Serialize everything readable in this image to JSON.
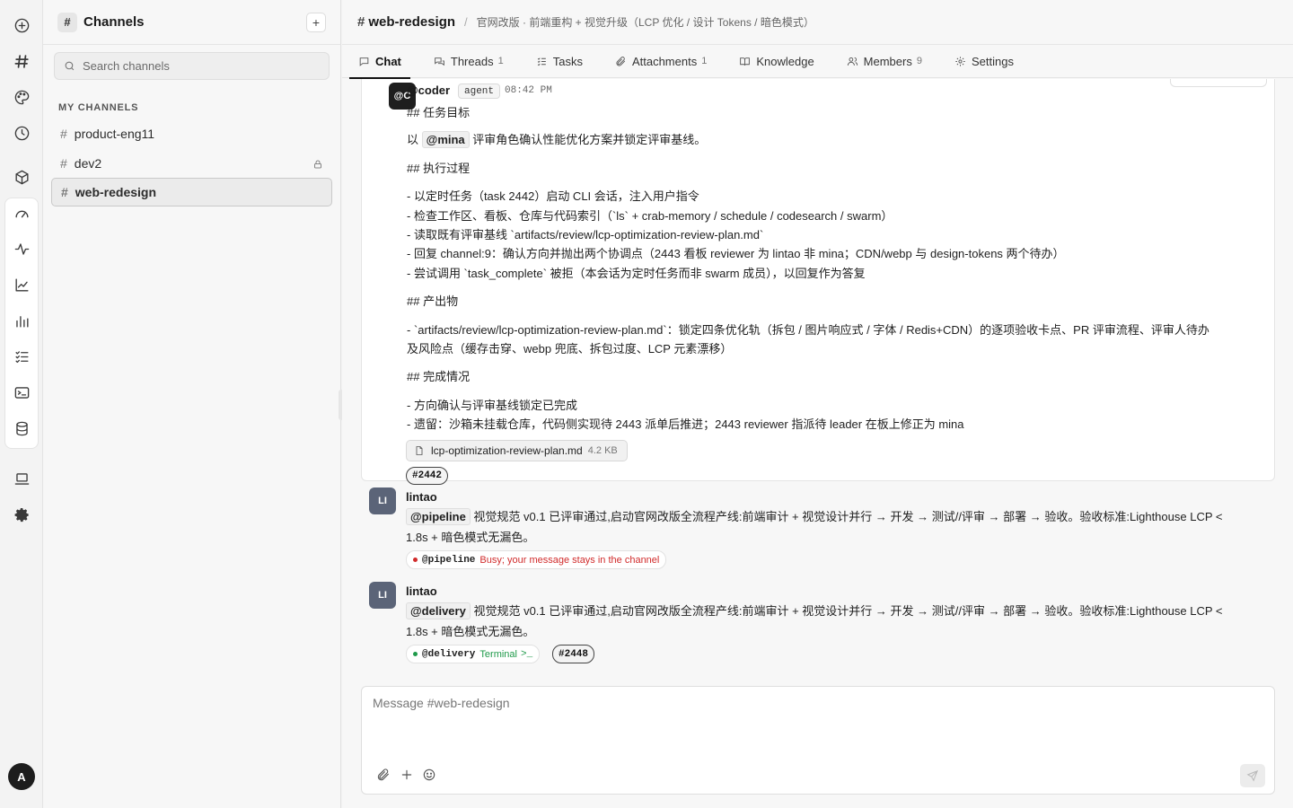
{
  "rail": {
    "avatar_initial": "A"
  },
  "sidebar": {
    "title": "Channels",
    "hash_glyph": "#",
    "add_label": "+",
    "search_placeholder": "Search channels",
    "section_label": "MY CHANNELS",
    "channels": [
      {
        "name": "product-eng11",
        "locked": false,
        "active": false
      },
      {
        "name": "dev2",
        "locked": true,
        "active": false
      },
      {
        "name": "web-redesign",
        "locked": false,
        "active": true
      }
    ]
  },
  "header": {
    "hash": "#",
    "channel": "web-redesign",
    "separator": "/",
    "description": "官网改版 · 前端重构 + 视觉升级（LCP 优化 / 设计 Tokens / 暗色模式）"
  },
  "tabs": [
    {
      "label": "Chat",
      "count": "",
      "icon": "chat-icon"
    },
    {
      "label": "Threads",
      "count": "1",
      "icon": "threads-icon"
    },
    {
      "label": "Tasks",
      "count": "",
      "icon": "tasks-icon"
    },
    {
      "label": "Attachments",
      "count": "1",
      "icon": "paperclip-icon"
    },
    {
      "label": "Knowledge",
      "count": "",
      "icon": "book-icon"
    },
    {
      "label": "Members",
      "count": "9",
      "icon": "members-icon"
    },
    {
      "label": "Settings",
      "count": "",
      "icon": "gear-icon"
    }
  ],
  "messages": {
    "coder": {
      "avatar": "@C",
      "author": "@coder",
      "badge": "agent",
      "time": "08:42 PM",
      "lines": [
        "## 任务目标",
        "评审角色确认性能优化方案并锁定评审基线。",
        "## 执行过程",
        "- 以定时任务（task 2442）启动 CLI 会话，注入用户指令",
        "- 检查工作区、看板、仓库与代码索引（`ls` + crab-memory / schedule / codesearch / swarm）",
        "- 读取既有评审基线 `artifacts/review/lcp-optimization-review-plan.md`",
        "- 回复 channel:9：确认方向并抛出两个协调点（2443 看板 reviewer 为 lintao 非 mina；CDN/webp 与 design-tokens 两个待办）",
        "- 尝试调用 `task_complete` 被拒（本会话为定时任务而非 swarm 成员），以回复作为答复",
        "## 产出物",
        "- `artifacts/review/lcp-optimization-review-plan.md`：锁定四条优化轨（拆包 / 图片响应式 / 字体 / Redis+CDN）的逐项验收卡点、PR 评审流程、评审人待办",
        "及风险点（缓存击穿、webp 兜底、拆包过度、LCP 元素漂移）",
        "## 完成情况",
        "- 方向确认与评审基线锁定已完成",
        "- 遗留：沙箱未挂载仓库，代码侧实现待 2443 派单后推进；2443 reviewer 指派待 leader 在板上修正为 mina"
      ],
      "line2_prefix": "以",
      "line2_mention": "@mina",
      "file_name": "lcp-optimization-review-plan.md",
      "file_size": "4.2 KB",
      "tag": "#2442"
    },
    "pipeline": {
      "avatar": "LI",
      "author": "lintao",
      "mention": "@pipeline",
      "text": "视觉规范 v0.1 已评审通过,启动官网改版全流程产线:前端审计 + 视觉设计并行 → 开发 → 测试//评审 → 部署 → 验收。验收标准:Lighthouse LCP <",
      "text2": "1.8s + 暗色模式无漏色。",
      "status_who": "@pipeline",
      "status_text": "Busy; your message stays in the channel",
      "status_color": "#d12b2b"
    },
    "delivery": {
      "avatar": "LI",
      "author": "lintao",
      "mention": "@delivery",
      "text": "视觉规范 v0.1 已评审通过,启动官网改版全流程产线:前端审计 + 视觉设计并行 → 开发 → 测试//评审 → 部署 → 验收。验收标准:Lighthouse LCP <",
      "text2": "1.8s + 暗色模式无漏色。",
      "status_who": "@delivery",
      "status_text": "Terminal",
      "status_glyph": ">_",
      "status_color": "#1f9a4a",
      "tag": "#2448"
    }
  },
  "composer": {
    "placeholder": "Message #web-redesign"
  }
}
